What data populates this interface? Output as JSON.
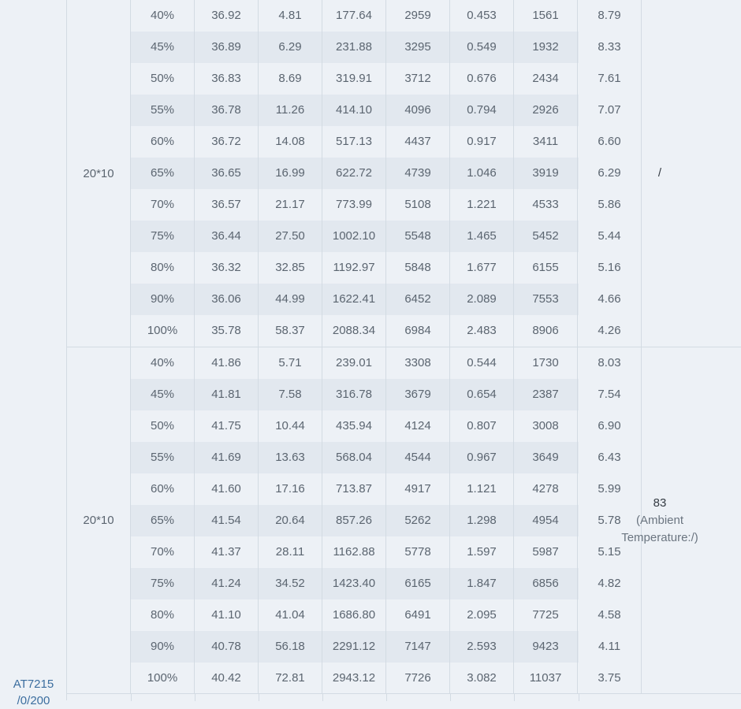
{
  "model": {
    "line1": "AT7215",
    "line2": "/0/200"
  },
  "groups": [
    {
      "size": "20*10",
      "note_main": "/",
      "note_sub": "",
      "rows": [
        [
          "40%",
          "36.92",
          "4.81",
          "177.64",
          "2959",
          "0.453",
          "1561",
          "8.79"
        ],
        [
          "45%",
          "36.89",
          "6.29",
          "231.88",
          "3295",
          "0.549",
          "1932",
          "8.33"
        ],
        [
          "50%",
          "36.83",
          "8.69",
          "319.91",
          "3712",
          "0.676",
          "2434",
          "7.61"
        ],
        [
          "55%",
          "36.78",
          "11.26",
          "414.10",
          "4096",
          "0.794",
          "2926",
          "7.07"
        ],
        [
          "60%",
          "36.72",
          "14.08",
          "517.13",
          "4437",
          "0.917",
          "3411",
          "6.60"
        ],
        [
          "65%",
          "36.65",
          "16.99",
          "622.72",
          "4739",
          "1.046",
          "3919",
          "6.29"
        ],
        [
          "70%",
          "36.57",
          "21.17",
          "773.99",
          "5108",
          "1.221",
          "4533",
          "5.86"
        ],
        [
          "75%",
          "36.44",
          "27.50",
          "1002.10",
          "5548",
          "1.465",
          "5452",
          "5.44"
        ],
        [
          "80%",
          "36.32",
          "32.85",
          "1192.97",
          "5848",
          "1.677",
          "6155",
          "5.16"
        ],
        [
          "90%",
          "36.06",
          "44.99",
          "1622.41",
          "6452",
          "2.089",
          "7553",
          "4.66"
        ],
        [
          "100%",
          "35.78",
          "58.37",
          "2088.34",
          "6984",
          "2.483",
          "8906",
          "4.26"
        ]
      ]
    },
    {
      "size": "20*10",
      "note_main": "83",
      "note_sub_1": "(Ambient",
      "note_sub_2": "Temperature:/)",
      "rows": [
        [
          "40%",
          "41.86",
          "5.71",
          "239.01",
          "3308",
          "0.544",
          "1730",
          "8.03"
        ],
        [
          "45%",
          "41.81",
          "7.58",
          "316.78",
          "3679",
          "0.654",
          "2387",
          "7.54"
        ],
        [
          "50%",
          "41.75",
          "10.44",
          "435.94",
          "4124",
          "0.807",
          "3008",
          "6.90"
        ],
        [
          "55%",
          "41.69",
          "13.63",
          "568.04",
          "4544",
          "0.967",
          "3649",
          "6.43"
        ],
        [
          "60%",
          "41.60",
          "17.16",
          "713.87",
          "4917",
          "1.121",
          "4278",
          "5.99"
        ],
        [
          "65%",
          "41.54",
          "20.64",
          "857.26",
          "5262",
          "1.298",
          "4954",
          "5.78"
        ],
        [
          "70%",
          "41.37",
          "28.11",
          "1162.88",
          "5778",
          "1.597",
          "5987",
          "5.15"
        ],
        [
          "75%",
          "41.24",
          "34.52",
          "1423.40",
          "6165",
          "1.847",
          "6856",
          "4.82"
        ],
        [
          "80%",
          "41.10",
          "41.04",
          "1686.80",
          "6491",
          "2.095",
          "7725",
          "4.58"
        ],
        [
          "90%",
          "40.78",
          "56.18",
          "2291.12",
          "7147",
          "2.593",
          "9423",
          "4.11"
        ],
        [
          "100%",
          "40.42",
          "72.81",
          "2943.12",
          "7726",
          "3.082",
          "11037",
          "3.75"
        ]
      ]
    }
  ]
}
